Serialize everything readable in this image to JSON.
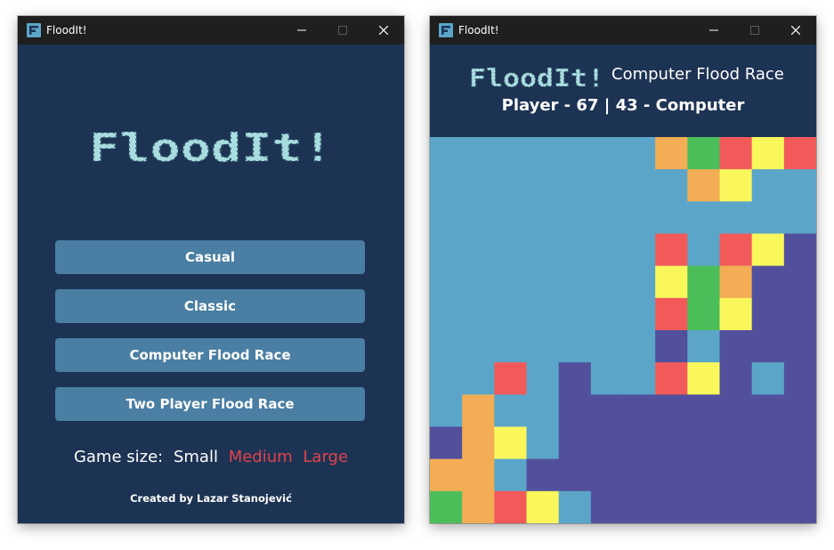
{
  "colors": {
    "window_bg": "#1d3354",
    "titlebar_bg": "#1f1f1f",
    "button_bg": "#4a7ea3",
    "logo_fill": "#a8dcdf",
    "logo_dot": "#2b5566",
    "size_inactive": "#e0434b"
  },
  "menu_window": {
    "title": "FloodIt!",
    "logo_text": "FloodIt!",
    "buttons": [
      {
        "label": "Casual"
      },
      {
        "label": "Classic"
      },
      {
        "label": "Computer Flood Race"
      },
      {
        "label": "Two Player Flood Race"
      }
    ],
    "game_size": {
      "label": "Game size:",
      "options": [
        {
          "label": "Small",
          "selected": true
        },
        {
          "label": "Medium",
          "selected": false
        },
        {
          "label": "Large",
          "selected": false
        }
      ]
    },
    "credit": "Created by Lazar Stanojević"
  },
  "race_window": {
    "title": "FloodIt!",
    "logo_text": "FloodIt!",
    "mode_title": "Computer Flood Race",
    "score_text": "Player - 67 | 43 - Computer",
    "board": {
      "cols": 12,
      "rows": 12,
      "palette": {
        "B": "#5ba6c8",
        "P": "#52509c",
        "R": "#f25a5a",
        "O": "#f2ad55",
        "G": "#4bbe5a",
        "Y": "#faf75d"
      },
      "grid": [
        "BBBBBBBOGRYR",
        "BBBBBBBBOYBB",
        "BBBBBBBBBBBB",
        "BBBBBBBRBRYP",
        "BBBBBBBYGOPP",
        "BBBBBBBRGYPP",
        "BBBBBBBPBPPP",
        "BBRBPBBRYPBP",
        "BOBBPPPPPPPP",
        "POYBPPPPPPPP",
        "OOBPPPPPPPPP",
        "GORYBPPPPPPP"
      ]
    }
  }
}
